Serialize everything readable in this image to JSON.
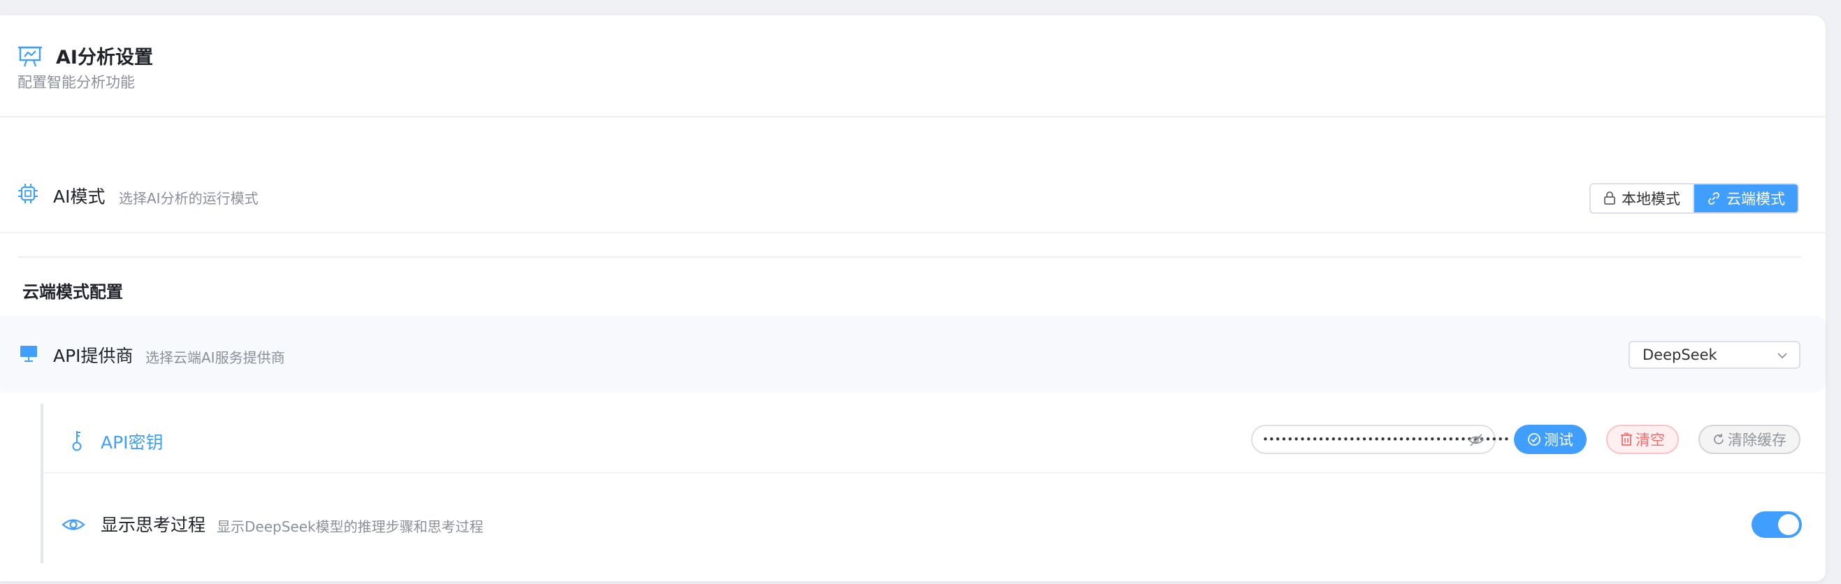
{
  "header": {
    "icon": "presentation-icon",
    "title": "AI分析设置",
    "subtitle": "配置智能分析功能"
  },
  "ai_mode": {
    "icon": "cpu-chip-icon",
    "title": "AI模式",
    "desc": "选择AI分析的运行模式",
    "options": [
      {
        "label": "本地模式",
        "icon": "lock-icon",
        "active": false
      },
      {
        "label": "云端模式",
        "icon": "link-icon",
        "active": true
      }
    ]
  },
  "cloud_section": {
    "title": "云端模式配置"
  },
  "provider": {
    "icon": "monitor-icon",
    "title": "API提供商",
    "desc": "选择云端AI服务提供商",
    "selected": "DeepSeek"
  },
  "api_key": {
    "icon": "key-icon",
    "title": "API密钥",
    "masked_value": "••••••••••••••••••••••••••••••••••••••••",
    "test_label": "测试",
    "clear_label": "清空",
    "cache_label": "清除缓存"
  },
  "show_thinking": {
    "icon": "eye-icon",
    "title": "显示思考过程",
    "desc": "显示DeepSeek模型的推理步骤和思考过程",
    "enabled": true
  },
  "colors": {
    "accent": "#409eff",
    "danger": "#f56c6c",
    "muted": "#909399"
  }
}
